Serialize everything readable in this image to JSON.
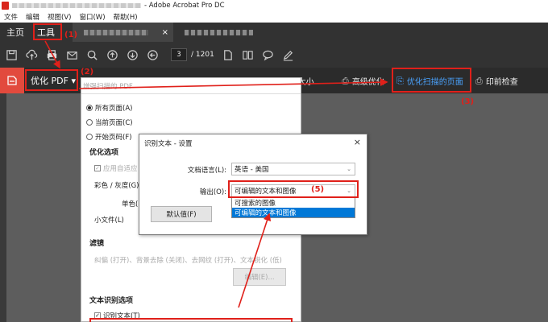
{
  "titlebar": {
    "app_title": "- Adobe Acrobat Pro DC"
  },
  "menubar": {
    "items": [
      "文件",
      "编辑",
      "视图(V)",
      "窗口(W)",
      "帮助(H)"
    ]
  },
  "tabs": {
    "home": "主页",
    "tools": "工具",
    "close": "×"
  },
  "toolbar": {
    "page_current": "3",
    "page_total": "/ 1201",
    "icons": [
      "save-icon",
      "upload-icon",
      "print-icon",
      "mail-icon",
      "search-icon",
      "page-up-icon",
      "page-down-icon",
      "back-icon",
      "single-page-icon",
      "two-page-icon",
      "comment-icon",
      "pen-icon"
    ]
  },
  "toolstrip": {
    "title": "优化 PDF",
    "caret": "▾",
    "reduce_size": "文件大小",
    "advanced": "高级优化",
    "optimize_scan": "优化扫描的页面",
    "preflight": "印前检查"
  },
  "panel": {
    "header": "增强扫描的 PDF",
    "radio_all": "所有页面(A)",
    "radio_current": "当前页面(C)",
    "radio_from": "开始页码(F)",
    "section_optimize": "优化选项",
    "auto_apply": "应用自适应",
    "color_gray": "彩色 / 灰度(G)",
    "mono": "单色(",
    "small_file": "小文件(L)",
    "section_filter": "滤镜",
    "filter_desc": "纠偏 (打开)、背景去除 (关闭)、去网纹 (打开)、文本锐化 (低)",
    "edit_button": "编辑(E)...",
    "section_ocr": "文本识别选项",
    "ocr_check": "识别文本(T)"
  },
  "dialog": {
    "title": "识别文本 - 设置",
    "close": "×",
    "lang_label": "文档语言(L):",
    "lang_value": "英语 - 美国",
    "output_label": "输出(O):",
    "output_value": "可编辑的文本和图像",
    "dropdown_options": [
      "可搜索的图像",
      "可编辑的文本和图像"
    ],
    "default_button": "默认值(F)"
  },
  "annotations": {
    "label_1": "(1)",
    "label_2": "(2)",
    "label_3": "(3)",
    "label_5": "(5)"
  },
  "colors": {
    "annotation_red": "#e0201a",
    "tool_accent": "#e24a3d",
    "link_blue": "#4aa3ff",
    "dark_bar": "#323232"
  }
}
